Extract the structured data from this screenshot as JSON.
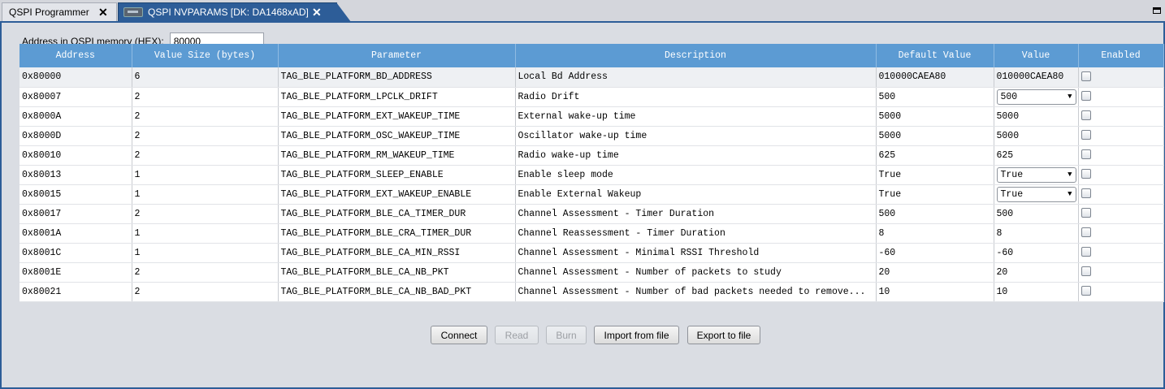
{
  "tabs": [
    {
      "label": "QSPI Programmer"
    },
    {
      "label": "QSPI NVPARAMS [DK: DA1468xAD]"
    }
  ],
  "address": {
    "label": "Address in QSPI memory (HEX):",
    "value": "80000"
  },
  "table": {
    "columns": [
      "Address",
      "Value Size (bytes)",
      "Parameter",
      "Description",
      "Default Value",
      "Value",
      "Enabled"
    ],
    "rows": [
      {
        "address": "0x80000",
        "size": "6",
        "parameter": "TAG_BLE_PLATFORM_BD_ADDRESS",
        "description": "Local Bd Address",
        "default": "010000CAEA80",
        "value": "010000CAEA80",
        "dropdown": false
      },
      {
        "address": "0x80007",
        "size": "2",
        "parameter": "TAG_BLE_PLATFORM_LPCLK_DRIFT",
        "description": "Radio Drift",
        "default": "500",
        "value": "500",
        "dropdown": true
      },
      {
        "address": "0x8000A",
        "size": "2",
        "parameter": "TAG_BLE_PLATFORM_EXT_WAKEUP_TIME",
        "description": "External wake-up time",
        "default": "5000",
        "value": "5000",
        "dropdown": false
      },
      {
        "address": "0x8000D",
        "size": "2",
        "parameter": "TAG_BLE_PLATFORM_OSC_WAKEUP_TIME",
        "description": "Oscillator wake-up time",
        "default": "5000",
        "value": "5000",
        "dropdown": false
      },
      {
        "address": "0x80010",
        "size": "2",
        "parameter": "TAG_BLE_PLATFORM_RM_WAKEUP_TIME",
        "description": "Radio wake-up time",
        "default": "625",
        "value": "625",
        "dropdown": false
      },
      {
        "address": "0x80013",
        "size": "1",
        "parameter": "TAG_BLE_PLATFORM_SLEEP_ENABLE",
        "description": "Enable sleep mode",
        "default": "True",
        "value": "True",
        "dropdown": true
      },
      {
        "address": "0x80015",
        "size": "1",
        "parameter": "TAG_BLE_PLATFORM_EXT_WAKEUP_ENABLE",
        "description": "Enable External Wakeup",
        "default": "True",
        "value": "True",
        "dropdown": true
      },
      {
        "address": "0x80017",
        "size": "2",
        "parameter": "TAG_BLE_PLATFORM_BLE_CA_TIMER_DUR",
        "description": "Channel Assessment - Timer Duration",
        "default": "500",
        "value": "500",
        "dropdown": false
      },
      {
        "address": "0x8001A",
        "size": "1",
        "parameter": "TAG_BLE_PLATFORM_BLE_CRA_TIMER_DUR",
        "description": "Channel Reassessment - Timer Duration",
        "default": "8",
        "value": "8",
        "dropdown": false
      },
      {
        "address": "0x8001C",
        "size": "1",
        "parameter": "TAG_BLE_PLATFORM_BLE_CA_MIN_RSSI",
        "description": "Channel Assessment - Minimal RSSI Threshold",
        "default": "-60",
        "value": "-60",
        "dropdown": false
      },
      {
        "address": "0x8001E",
        "size": "2",
        "parameter": "TAG_BLE_PLATFORM_BLE_CA_NB_PKT",
        "description": "Channel Assessment - Number of packets to study",
        "default": "20",
        "value": "20",
        "dropdown": false
      },
      {
        "address": "0x80021",
        "size": "2",
        "parameter": "TAG_BLE_PLATFORM_BLE_CA_NB_BAD_PKT",
        "description": "Channel Assessment - Number of bad packets needed to remove...",
        "default": "10",
        "value": "10",
        "dropdown": false
      }
    ]
  },
  "buttons": {
    "connect": "Connect",
    "read": "Read",
    "burn": "Burn",
    "import": "Import from file",
    "export": "Export to file"
  }
}
